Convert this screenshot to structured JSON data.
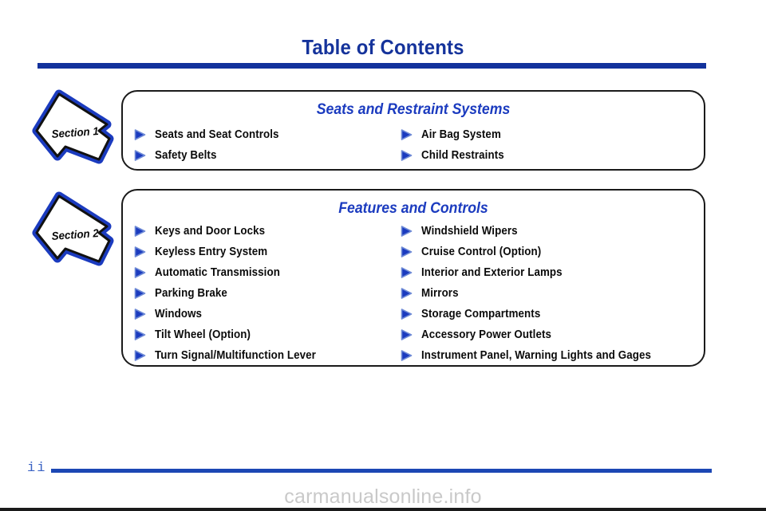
{
  "page": {
    "title": "Table of Contents",
    "page_number": "ii",
    "watermark": "carmanualsonline.info",
    "title_color": "#15339b",
    "rule_color": "#13329c",
    "section_title_color": "#1b3bbf",
    "bullet_color": "#1b3bbf",
    "badge_outline_color": "#1b3bbf"
  },
  "sections": [
    {
      "badge_label": "Section 1",
      "badge_icon": "arrow-banner-icon",
      "title": "Seats and Restraint Systems",
      "left_items": [
        {
          "bullet": "triangle-right-icon",
          "label": "Seats and Seat Controls"
        },
        {
          "bullet": "triangle-right-icon",
          "label": "Safety Belts"
        }
      ],
      "right_items": [
        {
          "bullet": "triangle-right-icon",
          "label": "Air Bag System"
        },
        {
          "bullet": "triangle-right-icon",
          "label": "Child Restraints"
        }
      ]
    },
    {
      "badge_label": "Section 2",
      "badge_icon": "arrow-banner-icon",
      "title": "Features and Controls",
      "left_items": [
        {
          "bullet": "triangle-right-icon",
          "label": "Keys and Door Locks"
        },
        {
          "bullet": "triangle-right-icon",
          "label": "Keyless Entry System"
        },
        {
          "bullet": "triangle-right-icon",
          "label": "Automatic Transmission"
        },
        {
          "bullet": "triangle-right-icon",
          "label": "Parking Brake"
        },
        {
          "bullet": "triangle-right-icon",
          "label": "Windows"
        },
        {
          "bullet": "triangle-right-icon",
          "label": "Tilt Wheel (Option)"
        },
        {
          "bullet": "triangle-right-icon",
          "label": "Turn Signal/Multifunction Lever"
        }
      ],
      "right_items": [
        {
          "bullet": "triangle-right-icon",
          "label": "Windshield Wipers"
        },
        {
          "bullet": "triangle-right-icon",
          "label": "Cruise Control (Option)"
        },
        {
          "bullet": "triangle-right-icon",
          "label": "Interior and Exterior Lamps"
        },
        {
          "bullet": "triangle-right-icon",
          "label": "Mirrors"
        },
        {
          "bullet": "triangle-right-icon",
          "label": "Storage Compartments"
        },
        {
          "bullet": "triangle-right-icon",
          "label": "Accessory Power Outlets"
        },
        {
          "bullet": "triangle-right-icon",
          "label": "Instrument Panel, Warning Lights and Gages"
        }
      ]
    }
  ]
}
